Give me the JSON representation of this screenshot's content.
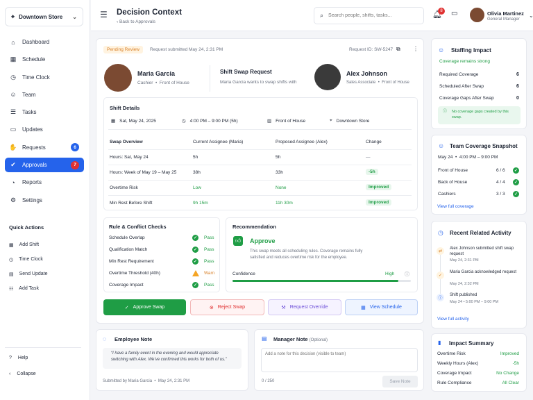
{
  "sidebar": {
    "store": "Downtown Store",
    "nav": [
      {
        "label": "Dashboard",
        "icon": "home-icon"
      },
      {
        "label": "Schedule",
        "icon": "calendar-icon"
      },
      {
        "label": "Time Clock",
        "icon": "clock-icon"
      },
      {
        "label": "Team",
        "icon": "users-icon"
      },
      {
        "label": "Tasks",
        "icon": "list-icon"
      },
      {
        "label": "Updates",
        "icon": "message-icon"
      },
      {
        "label": "Requests",
        "icon": "hand-icon",
        "badge": "6"
      },
      {
        "label": "Approvals",
        "icon": "approve-icon",
        "badge": "7"
      },
      {
        "label": "Reports",
        "icon": "report-icon"
      },
      {
        "label": "Settings",
        "icon": "gear-icon"
      }
    ],
    "quick_actions_title": "Quick Actions",
    "quick_actions": [
      {
        "label": "Add Shift",
        "icon": "calendar-plus-icon"
      },
      {
        "label": "Time Clock",
        "icon": "clock-icon"
      },
      {
        "label": "Send Update",
        "icon": "send-icon"
      },
      {
        "label": "Add Task",
        "icon": "task-plus-icon"
      }
    ],
    "help": "Help",
    "collapse": "Collapse"
  },
  "header": {
    "title": "Decision Context",
    "back": "Back to Approvals",
    "search_placeholder": "Search people, shifts, tasks...",
    "notif_count": "8",
    "user_name": "Olivia Martinez",
    "user_role": "General Manager"
  },
  "request": {
    "status": "Pending Review",
    "submitted": "Request submitted May 24, 2:31 PM",
    "id": "Request ID: SW-5247",
    "from_name": "Maria Garcia",
    "from_role": "Cashier",
    "from_dept": "Front of House",
    "type": "Shift Swap Request",
    "desc": "Maria Garcia wants to swap shifts with",
    "to_name": "Alex Johnson",
    "to_role": "Sales Associate",
    "to_dept": "Front of House"
  },
  "shift": {
    "title": "Shift Details",
    "date": "Sat, May 24, 2025",
    "time": "4:00 PM – 9:00 PM (5h)",
    "dept": "Front of House",
    "store": "Downtown Store"
  },
  "swap": {
    "headers": [
      "Swap Overview",
      "Current Assignee (Maria)",
      "Proposed Assignee (Alex)",
      "Change"
    ],
    "rows": [
      {
        "label": "Hours: Sat, May 24",
        "current": "5h",
        "proposed": "5h",
        "change": "—"
      },
      {
        "label": "Hours: Week of May 19 – May 25",
        "current": "38h",
        "proposed": "33h",
        "change": "-5h"
      },
      {
        "label": "Overtime Risk",
        "current": "Low",
        "proposed": "None",
        "change": "Improved"
      },
      {
        "label": "Min Rest Before Shift",
        "current": "9h 15m",
        "proposed": "11h 30m",
        "change": "Improved"
      }
    ]
  },
  "rules": {
    "title": "Rule & Conflict Checks",
    "items": [
      {
        "label": "Schedule Overlap",
        "result": "Pass"
      },
      {
        "label": "Qualification Match",
        "result": "Pass"
      },
      {
        "label": "Min Rest Requirement",
        "result": "Pass"
      },
      {
        "label": "Overtime Threshold (40h)",
        "result": "Warn"
      },
      {
        "label": "Coverage Impact",
        "result": "Pass"
      }
    ]
  },
  "recommendation": {
    "title": "Recommendation",
    "verdict": "Approve",
    "text": "This swap meets all scheduling rules. Coverage remains fully satisfied and reduces overtime risk for the employee.",
    "confidence_label": "Confidence",
    "confidence_value": "High",
    "confidence_level": 0.93
  },
  "actions": {
    "approve": "Approve Swap",
    "reject": "Reject Swap",
    "override": "Request Override",
    "schedule": "View Schedule"
  },
  "employee_note": {
    "title": "Employee Note",
    "text": "“I have a family event in the evening and would appreciate switching with Alex. We’ve confirmed this works for both of us.”",
    "by": "Submitted by Maria Garcia",
    "time": "May 24, 2:31 PM"
  },
  "manager_note": {
    "title": "Manager Note",
    "optional": "(Optional)",
    "placeholder": "Add a note for this decision (visible to team)",
    "count": "0 / 250",
    "save": "Save Note"
  },
  "staffing": {
    "title": "Staffing Impact",
    "status": "Coverage remains strong",
    "rows": [
      {
        "label": "Required Coverage",
        "value": "6"
      },
      {
        "label": "Scheduled After Swap",
        "value": "6"
      },
      {
        "label": "Coverage Gaps After Swap",
        "value": "0"
      }
    ],
    "note": "No coverage gaps created by this swap."
  },
  "coverage": {
    "title": "Team Coverage Snapshot",
    "date": "May 24",
    "time": "4:00 PM – 9:00 PM",
    "rows": [
      {
        "label": "Front of House",
        "value": "6 / 6"
      },
      {
        "label": "Back of House",
        "value": "4 / 4"
      },
      {
        "label": "Cashiers",
        "value": "3 / 3"
      }
    ],
    "link": "View full coverage"
  },
  "activity": {
    "title": "Recent Related Activity",
    "items": [
      {
        "text": "Alex Johnson submitted shift swap request",
        "time": "May 24, 2:31 PM"
      },
      {
        "text": "Maria Garcia acknowledged request",
        "time": "May 24, 2:32 PM"
      },
      {
        "text": "Shift published",
        "time": "May 24 • 5:00 PM – 9:00 PM"
      }
    ],
    "link": "View full activity"
  },
  "impact": {
    "title": "Impact Summary",
    "rows": [
      {
        "label": "Overtime Risk",
        "value": "Improved"
      },
      {
        "label": "Weekly Hours (Alex)",
        "value": "-5h"
      },
      {
        "label": "Coverage Impact",
        "value": "No Change"
      },
      {
        "label": "Rule Compliance",
        "value": "All Clear"
      }
    ]
  },
  "colors": {
    "primary": "#2563eb",
    "success": "#1f9d45",
    "danger": "#e03131",
    "warning": "#f5a524",
    "purple": "#6d4fd8"
  }
}
